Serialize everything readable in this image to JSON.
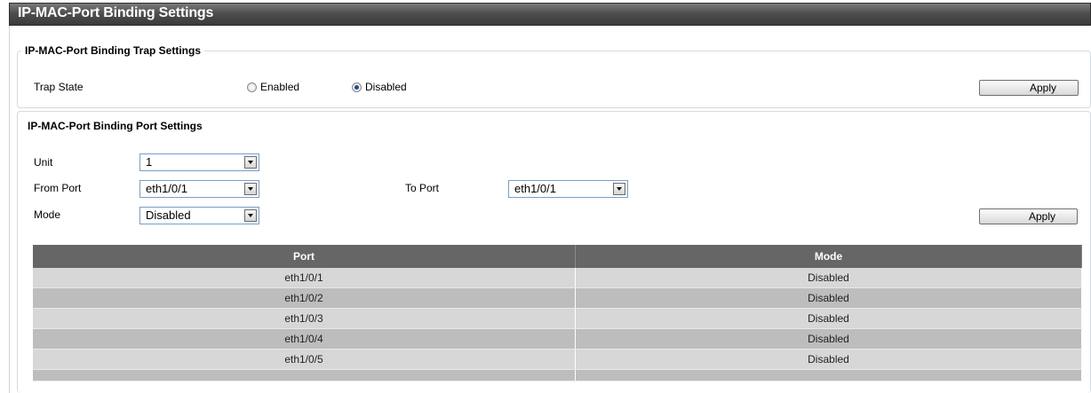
{
  "page_title": "IP-MAC-Port Binding Settings",
  "trap_settings": {
    "legend": "IP-MAC-Port Binding Trap Settings",
    "trap_state_label": "Trap State",
    "enabled_label": "Enabled",
    "disabled_label": "Disabled",
    "selected": "Disabled",
    "apply_label": "Apply"
  },
  "port_settings": {
    "legend": "IP-MAC-Port Binding Port Settings",
    "unit_label": "Unit",
    "unit_value": "1",
    "from_port_label": "From Port",
    "from_port_value": "eth1/0/1",
    "to_port_label": "To Port",
    "to_port_value": "eth1/0/1",
    "mode_label": "Mode",
    "mode_value": "Disabled",
    "apply_label": "Apply"
  },
  "table": {
    "headers": [
      "Port",
      "Mode"
    ],
    "rows": [
      [
        "eth1/0/1",
        "Disabled"
      ],
      [
        "eth1/0/2",
        "Disabled"
      ],
      [
        "eth1/0/3",
        "Disabled"
      ],
      [
        "eth1/0/4",
        "Disabled"
      ],
      [
        "eth1/0/5",
        "Disabled"
      ]
    ]
  }
}
